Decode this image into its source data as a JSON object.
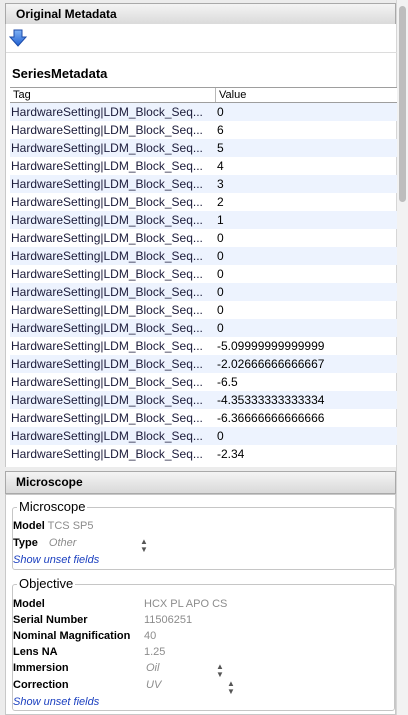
{
  "header": {
    "title": "Original Metadata"
  },
  "icons": {
    "export": "blue-down-arrow-icon"
  },
  "series": {
    "title": "SeriesMetadata",
    "columns": {
      "tag": "Tag",
      "value": "Value"
    },
    "rows": [
      {
        "tag": "HardwareSetting|LDM_Block_Seq...",
        "value": "0"
      },
      {
        "tag": "HardwareSetting|LDM_Block_Seq...",
        "value": "6"
      },
      {
        "tag": "HardwareSetting|LDM_Block_Seq...",
        "value": "5"
      },
      {
        "tag": "HardwareSetting|LDM_Block_Seq...",
        "value": "4"
      },
      {
        "tag": "HardwareSetting|LDM_Block_Seq...",
        "value": "3"
      },
      {
        "tag": "HardwareSetting|LDM_Block_Seq...",
        "value": "2"
      },
      {
        "tag": "HardwareSetting|LDM_Block_Seq...",
        "value": "1"
      },
      {
        "tag": "HardwareSetting|LDM_Block_Seq...",
        "value": "0"
      },
      {
        "tag": "HardwareSetting|LDM_Block_Seq...",
        "value": "0"
      },
      {
        "tag": "HardwareSetting|LDM_Block_Seq...",
        "value": "0"
      },
      {
        "tag": "HardwareSetting|LDM_Block_Seq...",
        "value": "0"
      },
      {
        "tag": "HardwareSetting|LDM_Block_Seq...",
        "value": "0"
      },
      {
        "tag": "HardwareSetting|LDM_Block_Seq...",
        "value": "0"
      },
      {
        "tag": "HardwareSetting|LDM_Block_Seq...",
        "value": "-5.09999999999999"
      },
      {
        "tag": "HardwareSetting|LDM_Block_Seq...",
        "value": "-2.02666666666667"
      },
      {
        "tag": "HardwareSetting|LDM_Block_Seq...",
        "value": "-6.5"
      },
      {
        "tag": "HardwareSetting|LDM_Block_Seq...",
        "value": "-4.35333333333334"
      },
      {
        "tag": "HardwareSetting|LDM_Block_Seq...",
        "value": "-6.36666666666666"
      },
      {
        "tag": "HardwareSetting|LDM_Block_Seq...",
        "value": "0"
      },
      {
        "tag": "HardwareSetting|LDM_Block_Seq...",
        "value": "-2.34"
      }
    ]
  },
  "microscope_panel": {
    "title": "Microscope",
    "group_title": "Microscope",
    "model_label": "Model",
    "model_value": "TCS SP5",
    "type_label": "Type",
    "type_value": "Other",
    "show_unset": "Show unset fields"
  },
  "objective": {
    "title": "Objective",
    "model_label": "Model",
    "model_value": "HCX PL APO CS",
    "serial_label": "Serial Number",
    "serial_value": "11506251",
    "mag_label": "Nominal Magnification",
    "mag_value": "40",
    "na_label": "Lens NA",
    "na_value": "1.25",
    "immersion_label": "Immersion",
    "immersion_value": "Oil",
    "correction_label": "Correction",
    "correction_value": "UV",
    "show_unset": "Show unset fields"
  }
}
